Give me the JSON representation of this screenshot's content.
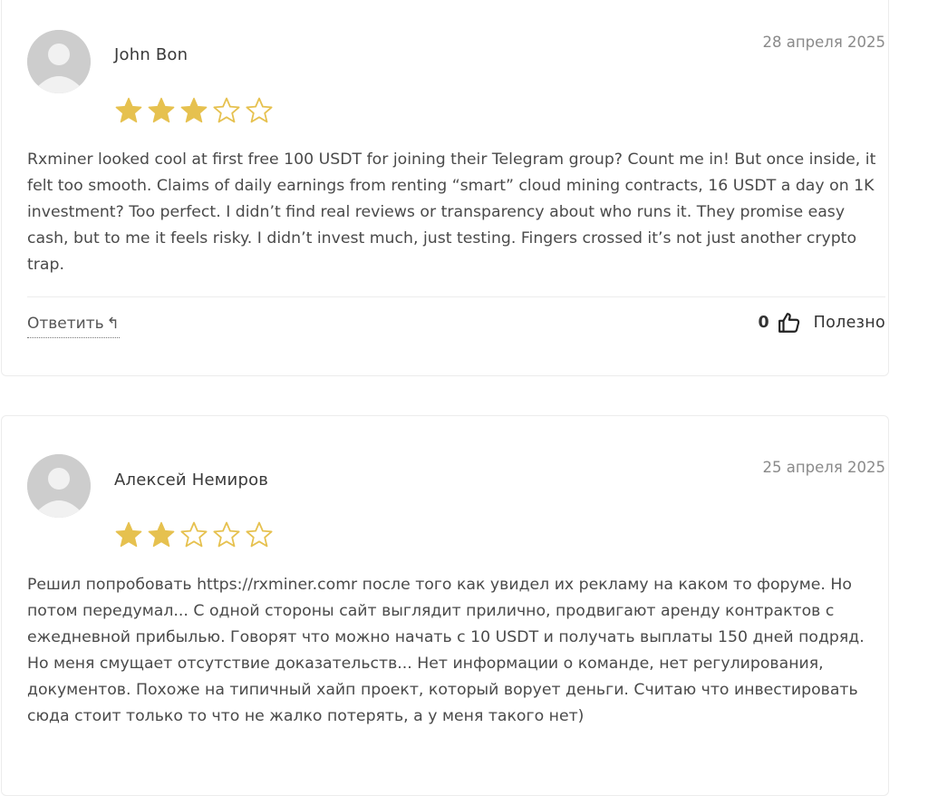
{
  "reviews": [
    {
      "author": "John Bon",
      "date": "28 апреля 2025",
      "rating": 3,
      "max_rating": 5,
      "text": "Rxminer looked cool at first free 100 USDT for joining their Telegram group? Count me in! But once inside, it felt too smooth. Claims of daily earnings from renting “smart” cloud mining contracts, 16 USDT a day on 1K investment? Too perfect. I didn’t find real reviews or transparency about who runs it. They promise easy cash, but to me it feels risky. I didn’t invest much, just testing. Fingers crossed it’s not just another crypto trap.",
      "reply_label": "Ответить",
      "helpful_count": "0",
      "helpful_label": "Полезно"
    },
    {
      "author": "Алексей Немиров",
      "date": "25 апреля 2025",
      "rating": 2,
      "max_rating": 5,
      "text": "Решил попробовать https://rxminer.comr после того как увидел их рекламу на каком то форуме. Но потом передумал... С одной стороны сайт выглядит прилично, продвигают аренду контрактов с ежедневной прибылью. Говорят что можно начать с 10 USDT и получать выплаты 150 дней подряд. Но меня смущает отсутствие доказательств... Нет информации о команде, нет регулирования, документов. Похоже на типичный хайп проект, который ворует деньги. Считаю что инвестировать сюда стоит только то что не жалко потерять, а у меня такого нет)"
    }
  ],
  "colors": {
    "star_filled": "#e6c14f",
    "star_empty": "#e6c14f",
    "avatar_bg": "#cdcdcd",
    "avatar_fg": "#f1f1f1"
  },
  "icons": {
    "avatar": "user-silhouette-icon",
    "star": "star-icon",
    "reply": "reply-arrow-icon",
    "helpful": "thumbs-up-icon"
  }
}
